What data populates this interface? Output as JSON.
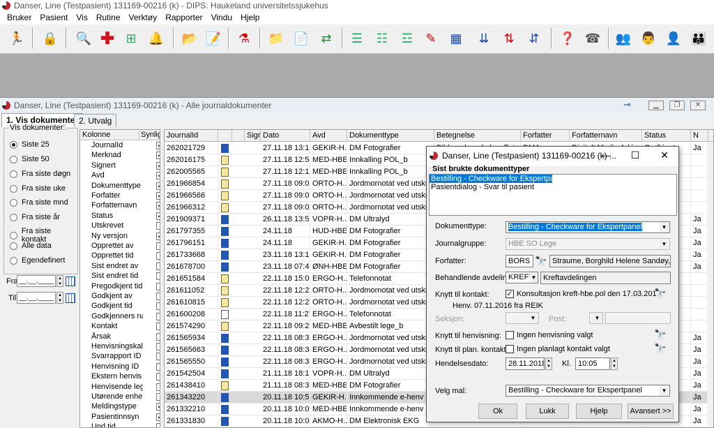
{
  "app": {
    "title": "Danser, Line (Testpasient)  131169-00216 (k) - DIPS: Haukeland universitetssjukehus",
    "menu": [
      "Bruker",
      "Pasient",
      "Vis",
      "Rutine",
      "Verktøy",
      "Rapporter",
      "Vindu",
      "Hjelp"
    ]
  },
  "toolbar": {
    "icons": [
      "exit-icon",
      "lock-icon",
      "search-patient-icon",
      "red-cross-icon",
      "tree-icon",
      "bell-icon",
      "pasient-folder-icon",
      "note-icon",
      "flask-icon",
      "folder-open-icon",
      "document-icon",
      "transfer-icon",
      "list-down-icon",
      "list-up-icon",
      "list-edit-icon",
      "pen-icon",
      "table-icon",
      "arrows-down-icon",
      "arrows-updown-icon",
      "help-icon",
      "phone-icon",
      "doctor-1-icon",
      "doctor-2-icon",
      "doctor-3-icon",
      "doctor-4-icon"
    ]
  },
  "window": {
    "title": "Danser, Line (Testpasient)  131169-00216 (k) - Alle journaldokumenter",
    "tabs": [
      "1. Vis dokumenter",
      "2. Utvalg"
    ]
  },
  "filter": {
    "legend": "Vis dokumenter:",
    "options": [
      "Siste 25",
      "Siste 50",
      "Fra siste døgn",
      "Fra siste uke",
      "Fra siste mnd",
      "Fra siste år",
      "Fra siste kontakt",
      "Alle data",
      "Egendefinert"
    ],
    "selected": "Siste 25",
    "fra_label": "Fra",
    "til_label": "Til"
  },
  "columns_chooser": {
    "header_kolonne": "Kolonne",
    "header_synlig": "Synlig",
    "rows": [
      {
        "name": "JournalId",
        "visible": true
      },
      {
        "name": "Merknad",
        "visible": true
      },
      {
        "name": "Signert",
        "visible": true
      },
      {
        "name": "Avd",
        "visible": true
      },
      {
        "name": "Dokumenttype",
        "visible": true
      },
      {
        "name": "Forfatter",
        "visible": true
      },
      {
        "name": "Forfatternavn",
        "visible": true
      },
      {
        "name": "Status",
        "visible": true
      },
      {
        "name": "Utskrevet",
        "visible": false
      },
      {
        "name": "Ny versjon",
        "visible": true
      },
      {
        "name": "Opprettet av",
        "visible": false
      },
      {
        "name": "Opprettet tid",
        "visible": false
      },
      {
        "name": "Sist endret av",
        "visible": false
      },
      {
        "name": "Sist endret tid",
        "visible": false
      },
      {
        "name": "Pregodkjent tid",
        "visible": false
      },
      {
        "name": "Godkjent av",
        "visible": false
      },
      {
        "name": "Godkjent tid",
        "visible": false
      },
      {
        "name": "Godkjenners na",
        "visible": false
      },
      {
        "name": "Kontakt",
        "visible": false
      },
      {
        "name": "Årsak",
        "visible": false
      },
      {
        "name": "Henvisningskal",
        "visible": false
      },
      {
        "name": "Svarrapport ID",
        "visible": false
      },
      {
        "name": "Henvisning ID",
        "visible": false
      },
      {
        "name": "Ekstern henvis",
        "visible": false
      },
      {
        "name": "Henvisende leg",
        "visible": false
      },
      {
        "name": "Utørende enhe",
        "visible": false
      },
      {
        "name": "Meldingstype",
        "visible": true
      },
      {
        "name": "Pasientinnsyn",
        "visible": true
      },
      {
        "name": "Und.tid",
        "visible": false
      }
    ]
  },
  "grid": {
    "headers": [
      "JournalId",
      "",
      "",
      "Sigr",
      "Dato",
      "Avd",
      "Dokumenttype",
      "Betegnelse",
      "Forfatter",
      "Forfatternavn",
      "Status",
      "N"
    ],
    "rows": [
      {
        "id": "262021729",
        "icon": "scan",
        "dato": "27.11.18 13:14",
        "avd": "GEKIR-H...",
        "type": "DM Fotografier",
        "beteg": "Bildeundersøkelse: Foto/V...",
        "forf": "DMA",
        "forfn": "Digitalt Media Arkiv",
        "status": "Godkjent",
        "n": "Ja"
      },
      {
        "id": "262016175",
        "icon": "note",
        "dato": "27.11.18 12:59",
        "avd": "MED-HBE",
        "type": "Innkalling POL_b",
        "beteg": "",
        "forf": "",
        "forfn": "",
        "status": "",
        "n": ""
      },
      {
        "id": "262005565",
        "icon": "note",
        "dato": "27.11.18 12:10",
        "avd": "MED-HBE",
        "type": "Innkalling POL_b",
        "beteg": "",
        "forf": "",
        "forfn": "",
        "status": "",
        "n": ""
      },
      {
        "id": "261966854",
        "icon": "note",
        "dato": "27.11.18 09:06",
        "avd": "ORTO-H...",
        "type": "Jordmornotat ved utskrivin...",
        "beteg": "",
        "forf": "",
        "forfn": "",
        "status": "",
        "n": ""
      },
      {
        "id": "261966566",
        "icon": "note",
        "dato": "27.11.18 09:05",
        "avd": "ORTO-H...",
        "type": "Jordmornotat ved utskrivin...",
        "beteg": "",
        "forf": "",
        "forfn": "",
        "status": "",
        "n": ""
      },
      {
        "id": "261966312",
        "icon": "note",
        "dato": "27.11.18 09:03",
        "avd": "ORTO-H...",
        "type": "Jordmornotat ved utskrivin...",
        "beteg": "",
        "forf": "",
        "forfn": "",
        "status": "",
        "n": ""
      },
      {
        "id": "261909371",
        "icon": "scan",
        "dato": "26.11.18 13:53",
        "avd": "VOPR-H...",
        "type": "DM Ultralyd",
        "beteg": "",
        "forf": "",
        "forfn": "",
        "status": "",
        "n": "Ja"
      },
      {
        "id": "261797355",
        "icon": "scan",
        "dato": "24.11.18",
        "avd": "HUD-HBE",
        "type": "DM Fotografier",
        "beteg": "",
        "forf": "",
        "forfn": "",
        "status": "",
        "n": "Ja"
      },
      {
        "id": "261796151",
        "icon": "scan",
        "dato": "24.11.18",
        "avd": "GEKIR-H...",
        "type": "DM Fotografier",
        "beteg": "",
        "forf": "",
        "forfn": "",
        "status": "",
        "n": "Ja"
      },
      {
        "id": "261733668",
        "icon": "scan",
        "dato": "23.11.18 13:10",
        "avd": "GEKIR-H...",
        "type": "DM Fotografier",
        "beteg": "",
        "forf": "",
        "forfn": "",
        "status": "",
        "n": "Ja"
      },
      {
        "id": "261678700",
        "icon": "scan",
        "dato": "23.11.18 07:47",
        "avd": "ØNH-HBE",
        "type": "DM Fotografier",
        "beteg": "",
        "forf": "",
        "forfn": "",
        "status": "",
        "n": "Ja"
      },
      {
        "id": "261651584",
        "icon": "note",
        "dato": "22.11.18 15:08",
        "avd": "ERGO-H...",
        "type": "Telefonnotat",
        "beteg": "",
        "forf": "",
        "forfn": "",
        "status": "",
        "n": ""
      },
      {
        "id": "261611052",
        "icon": "note",
        "dato": "22.11.18 12:26",
        "avd": "ORTO-H...",
        "type": "Jordmornotat ved utskrivin...",
        "beteg": "",
        "forf": "",
        "forfn": "",
        "status": "",
        "n": ""
      },
      {
        "id": "261610815",
        "icon": "note",
        "dato": "22.11.18 12:25",
        "avd": "ORTO-H...",
        "type": "Jordmornotat ved utskrivin...",
        "beteg": "",
        "forf": "",
        "forfn": "",
        "status": "",
        "n": ""
      },
      {
        "id": "261600208",
        "icon": "audio",
        "dato": "22.11.18 11:27",
        "avd": "ERGO-H...",
        "type": "Telefonnotat",
        "beteg": "",
        "forf": "",
        "forfn": "",
        "status": "",
        "n": ""
      },
      {
        "id": "261574290",
        "icon": "note",
        "dato": "22.11.18 09:29",
        "avd": "MED-HBE",
        "type": "Avbestilt lege_b",
        "beteg": "",
        "forf": "",
        "forfn": "",
        "status": "",
        "n": ""
      },
      {
        "id": "261565934",
        "icon": "scan",
        "dato": "22.11.18 08:36",
        "avd": "ERGO-H...",
        "type": "Jordmornotat ved utskrivin...",
        "beteg": "",
        "forf": "",
        "forfn": "",
        "status": "",
        "n": "Ja"
      },
      {
        "id": "261565663",
        "icon": "scan",
        "dato": "22.11.18 08:35",
        "avd": "ERGO-H...",
        "type": "Jordmornotat ved utskrivin...",
        "beteg": "",
        "forf": "",
        "forfn": "",
        "status": "",
        "n": "Ja"
      },
      {
        "id": "261565550",
        "icon": "scan",
        "dato": "22.11.18 08:34",
        "avd": "ERGO-H...",
        "type": "Jordmornotat ved utskrivin...",
        "beteg": "",
        "forf": "",
        "forfn": "",
        "status": "",
        "n": "Ja"
      },
      {
        "id": "261542504",
        "icon": "scan",
        "dato": "21.11.18 18:18",
        "avd": "VOPR-H...",
        "type": "DM Ultralyd",
        "beteg": "",
        "forf": "",
        "forfn": "",
        "status": "",
        "n": "Ja"
      },
      {
        "id": "261438410",
        "icon": "note",
        "dato": "21.11.18 08:32",
        "avd": "MED-HBE",
        "type": "DM Fotografier",
        "beteg": "",
        "forf": "",
        "forfn": "",
        "status": "",
        "n": "Ja"
      },
      {
        "id": "261343220",
        "icon": "scan",
        "dato": "20.11.18 10:50",
        "avd": "GEKIR-H...",
        "type": "Innkommende e-henv SO ...",
        "beteg": "",
        "forf": "",
        "forfn": "",
        "status": "",
        "n": "Ja",
        "sel": true
      },
      {
        "id": "261332210",
        "icon": "scan",
        "dato": "20.11.18 10:02",
        "avd": "MED-HBE",
        "type": "Innkommende e-henv SO ...",
        "beteg": "",
        "forf": "",
        "forfn": "",
        "status": "",
        "n": "Ja"
      },
      {
        "id": "261331830",
        "icon": "scan",
        "dato": "20.11.18 10:00",
        "avd": "AKMO-H...",
        "type": "DM Elektronisk EKG",
        "beteg": "",
        "forf": "",
        "forfn": "",
        "status": "",
        "n": "Ja"
      }
    ]
  },
  "dialog": {
    "title": "Danser, Line (Testpasient)  131169-00216 (k) ...",
    "recent_label": "Sist brukte dokumenttyper",
    "recent_items": [
      "Bestilling - Checkware for Ekspertpanel",
      "Pasientdialog - Svar til pasient"
    ],
    "dokumenttype_label": "Dokumenttype:",
    "dokumenttype_value": "Bestilling - Checkware for Ekspertpanel",
    "journalgruppe_label": "Journalgruppe:",
    "journalgruppe_value": "HBE SO Lege",
    "forfatter_label": "Forfatter:",
    "forfatter_code": "BORS",
    "forfatter_name": "Straume, Borghild Helene Sandøy, Hels",
    "avdeling_label": "Behandlende avdeling:",
    "avdeling_code": "KREFT",
    "avdeling_name": "Kreftavdelingen",
    "kontakt_label": "Knytt til kontakt:",
    "kontakt_text": "Konsultasjon kreft-hbe.pol den 17.03.201",
    "kontakt_sub": "Henv. 07.11.2016 fra REIK",
    "seksjon_label": "Seksjon:",
    "post_label": "Post:",
    "henvisning_label": "Knytt til henvisning:",
    "henvisning_text": "Ingen henvisning valgt",
    "plan_label": "Knytt til plan. kontakt:",
    "plan_text": "Ingen planlagt kontakt valgt",
    "hendelse_label": "Hendelsesdato:",
    "hendelse_dato": "28.11.2018",
    "kl_label": "Kl.",
    "kl_value": "10:05",
    "mal_label": "Velg mal:",
    "mal_value": "Bestilling - Checkware for Ekspertpanel",
    "buttons": {
      "ok": "Ok",
      "lukk": "Lukk",
      "hjelp": "Hjelp",
      "avansert": "Avansert >>"
    }
  }
}
